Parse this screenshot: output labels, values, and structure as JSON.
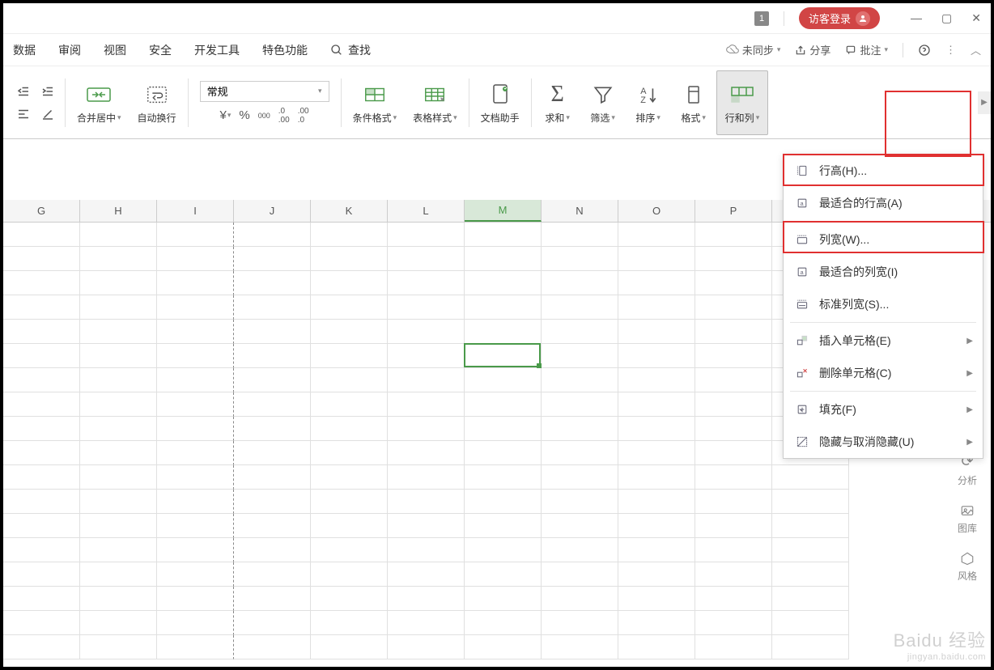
{
  "titleBar": {
    "badge": "1",
    "guestLogin": "访客登录"
  },
  "menuBar": {
    "items": [
      "数据",
      "审阅",
      "视图",
      "安全",
      "开发工具",
      "特色功能"
    ],
    "search": "查找",
    "right": {
      "unsync": "未同步",
      "share": "分享",
      "annotate": "批注"
    }
  },
  "toolbar": {
    "mergeCenter": "合并居中",
    "autoWrap": "自动换行",
    "formatSelect": "常规",
    "condFormat": "条件格式",
    "tableStyle": "表格样式",
    "docAssist": "文档助手",
    "sum": "求和",
    "filter": "筛选",
    "sort": "排序",
    "format": "格式",
    "rowCol": "行和列"
  },
  "columns": [
    "G",
    "H",
    "I",
    "J",
    "K",
    "L",
    "M",
    "N",
    "O",
    "P"
  ],
  "selectedColumn": "M",
  "dropdown": {
    "rowHeight": "行高(H)...",
    "bestRowHeight": "最适合的行高(A)",
    "colWidth": "列宽(W)...",
    "bestColWidth": "最适合的列宽(I)",
    "stdColWidth": "标准列宽(S)...",
    "insertCell": "插入单元格(E)",
    "deleteCell": "删除单元格(C)",
    "fill": "填充(F)",
    "hideUnhide": "隐藏与取消隐藏(U)"
  },
  "sidebar": {
    "analysis": "分析",
    "gallery": "图库",
    "style": "风格"
  },
  "watermark": {
    "main": "Baidu 经验",
    "sub": "jingyan.baidu.com"
  }
}
